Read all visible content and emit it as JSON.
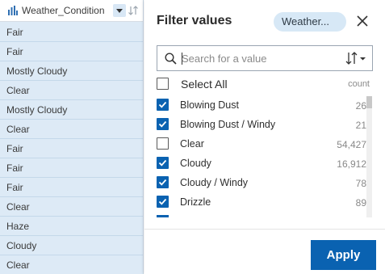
{
  "column": {
    "header_title": "Weather_Condition",
    "rows": [
      "Fair",
      "Fair",
      "Mostly Cloudy",
      "Clear",
      "Mostly Cloudy",
      "Clear",
      "Fair",
      "Fair",
      "Fair",
      "Clear",
      "Haze",
      "Cloudy",
      "Clear"
    ]
  },
  "panel": {
    "title": "Filter values",
    "field_chip": "Weather...",
    "search": {
      "placeholder": "Search for a value"
    },
    "select_all_label": "Select All",
    "count_header": "count",
    "items": [
      {
        "label": "Blowing Dust",
        "count": "26",
        "checked": true
      },
      {
        "label": "Blowing Dust / Windy",
        "count": "21",
        "checked": true
      },
      {
        "label": "Clear",
        "count": "54,427",
        "checked": false
      },
      {
        "label": "Cloudy",
        "count": "16,912",
        "checked": true
      },
      {
        "label": "Cloudy / Windy",
        "count": "78",
        "checked": true
      },
      {
        "label": "Drizzle",
        "count": "89",
        "checked": true
      }
    ],
    "apply_label": "Apply"
  },
  "colors": {
    "accent": "#0a62b1",
    "column_bg": "#ddeaf6",
    "chip_bg": "#d7e8f6"
  },
  "icons": {
    "header": [
      "bar-chart-icon",
      "chevron-down-icon",
      "sort-icon"
    ],
    "panel": [
      "close-icon",
      "search-icon",
      "sort-options-icon",
      "checkmark-icon"
    ]
  }
}
